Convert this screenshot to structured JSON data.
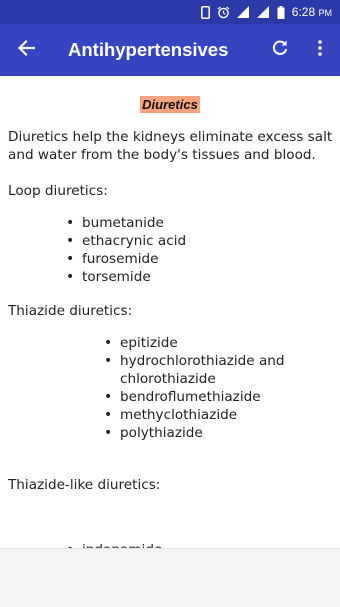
{
  "status_bar": {
    "time": "6:28",
    "ampm": "PM"
  },
  "toolbar": {
    "title": "Antihypertensives"
  },
  "content": {
    "heading": "Diuretics",
    "intro": "Diuretics help the kidneys eliminate excess salt and water from the body's tissues and blood.",
    "loop": {
      "label": "Loop diuretics:",
      "items": [
        "bumetanide",
        "ethacrynic acid",
        "furosemide",
        "torsemide"
      ]
    },
    "thiazide": {
      "label": "Thiazide diuretics:",
      "items": [
        "epitizide",
        "hydrochlorothiazide and chlorothiazide",
        "bendroflumethiazide",
        "methyclothiazide",
        "polythiazide"
      ]
    },
    "thiazide_like": {
      "label": "Thiazide-like diuretics:",
      "items": [
        "indapamide"
      ]
    }
  },
  "icons": {
    "back": "arrow-back-icon",
    "refresh": "refresh-icon",
    "more": "more-vert-icon"
  },
  "colors": {
    "status_bar": "#2b3aa8",
    "toolbar": "#3544c0",
    "heading_highlight": "#f4a47e"
  }
}
